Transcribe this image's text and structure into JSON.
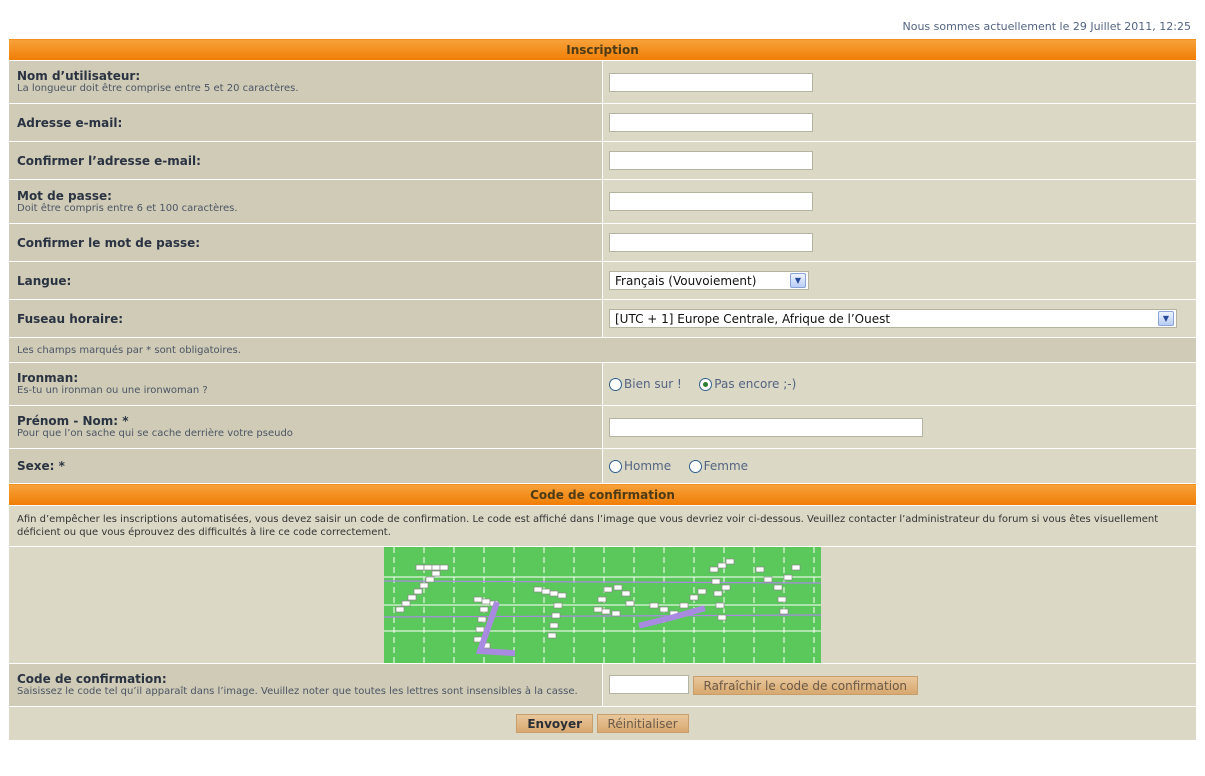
{
  "header": {
    "date_text": "Nous sommes actuellement le 29 Juillet 2011, 12:25"
  },
  "form": {
    "section_title": "Inscription",
    "fields": {
      "username": {
        "label": "Nom d’utilisateur:",
        "hint": "La longueur doit être comprise entre 5 et 20 caractères.",
        "value": ""
      },
      "email": {
        "label": "Adresse e-mail:",
        "value": ""
      },
      "email_confirm": {
        "label": "Confirmer l’adresse e-mail:",
        "value": ""
      },
      "password": {
        "label": "Mot de passe:",
        "hint": "Doit être compris entre 6 et 100 caractères.",
        "value": ""
      },
      "password_confirm": {
        "label": "Confirmer le mot de passe:",
        "value": ""
      },
      "language": {
        "label": "Langue:",
        "selected": "Français (Vouvoiement)"
      },
      "timezone": {
        "label": "Fuseau horaire:",
        "selected": "[UTC + 1] Europe Centrale, Afrique de l’Ouest"
      },
      "required_note": "Les champs marqués par * sont obligatoires.",
      "ironman": {
        "label": "Ironman:",
        "hint": "Es-tu un ironman ou une ironwoman ?",
        "option1": "Bien sur !",
        "option2": "Pas encore ;-)",
        "selected": "option2"
      },
      "full_name": {
        "label": "Prénom - Nom: *",
        "hint": "Pour que l’on sache qui se cache derrière votre pseudo",
        "value": ""
      },
      "sex": {
        "label": "Sexe: *",
        "option1": "Homme",
        "option2": "Femme"
      }
    }
  },
  "confirmation": {
    "section_title": "Code de confirmation",
    "explanation": "Afin d’empêcher les inscriptions automatisées, vous devez saisir un code de confirmation. Le code est affiché dans l’image que vous devriez voir ci-dessous. Veuillez contacter l’administrateur du forum si vous êtes visuellement déficient ou que vous éprouvez des difficultés à lire ce code correctement.",
    "code_label": "Code de confirmation:",
    "code_hint": "Saisissez le code tel qu’il apparaît dans l’image. Veuillez noter que toutes les lettres sont insensibles à la casse.",
    "code_value": "",
    "refresh_label": "Rafraîchir le code de confirmation",
    "captcha_colors": {
      "background": "#5ac85a",
      "bars": "#ffffff",
      "accent": "#a88be0"
    }
  },
  "buttons": {
    "submit": "Envoyer",
    "reset": "Réinitialiser"
  },
  "colors": {
    "header_orange": "#f07d05",
    "label_bg": "#cfcbb6",
    "value_bg": "#dbd8c6",
    "button_bg": "#d8a86f"
  }
}
